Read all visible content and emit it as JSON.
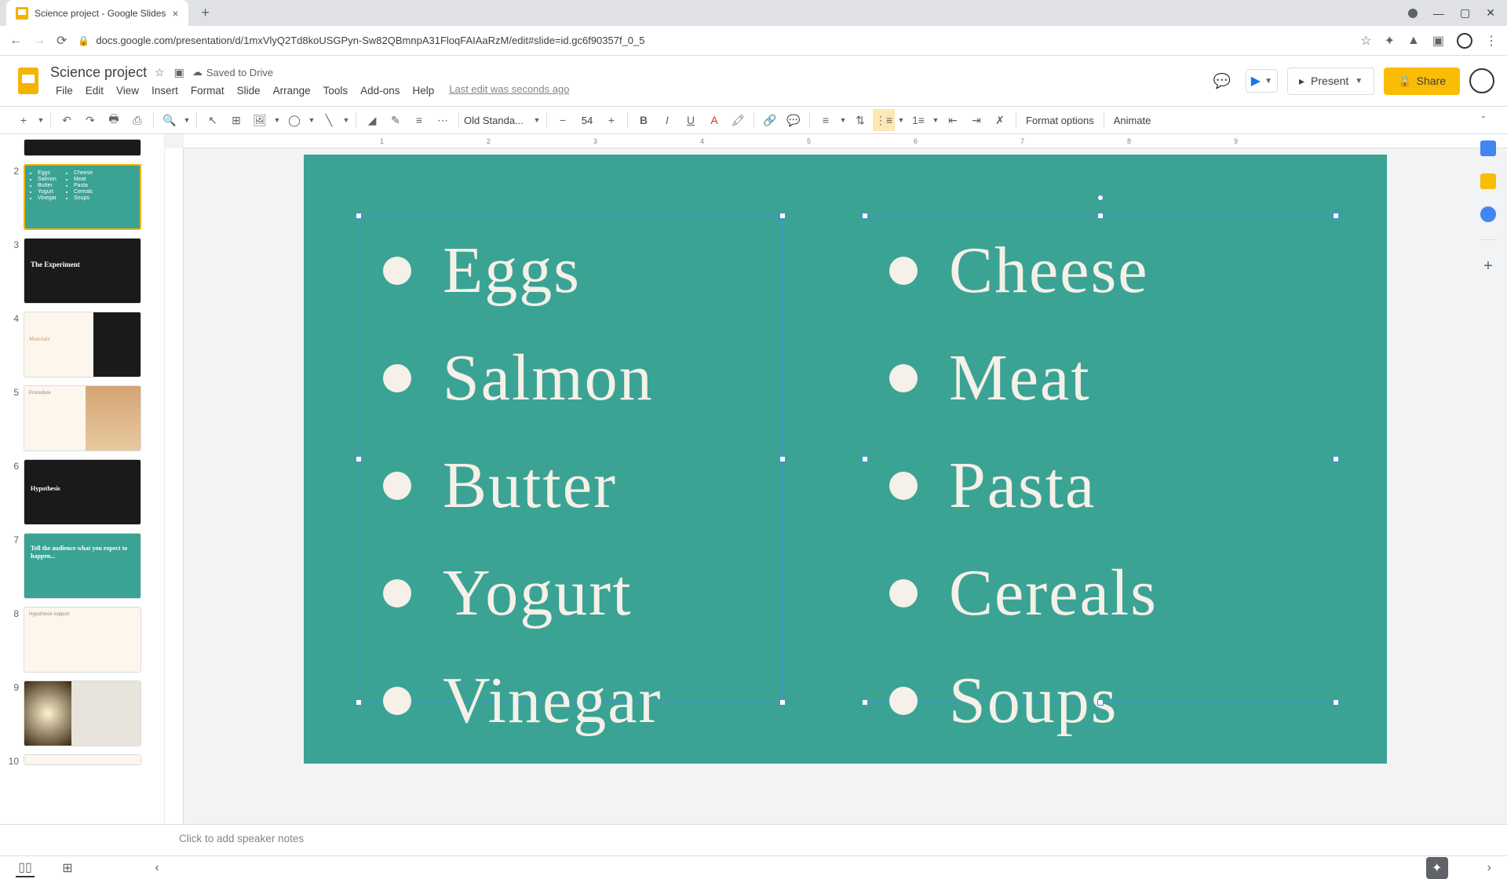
{
  "browser": {
    "tab_title": "Science project - Google Slides",
    "url": "docs.google.com/presentation/d/1mxVlyQ2Td8koUSGPyn-Sw82QBmnpA31FloqFAIAaRzM/edit#slide=id.gc6f90357f_0_5"
  },
  "doc": {
    "title": "Science project",
    "save_status": "Saved to Drive",
    "last_edit": "Last edit was seconds ago"
  },
  "menus": [
    "File",
    "Edit",
    "View",
    "Insert",
    "Format",
    "Slide",
    "Arrange",
    "Tools",
    "Add-ons",
    "Help"
  ],
  "header_buttons": {
    "present": "Present",
    "share": "Share"
  },
  "toolbar": {
    "font": "Old Standa...",
    "font_size": "54",
    "format_options": "Format options",
    "animate": "Animate"
  },
  "slide_content": {
    "left_list": [
      "Eggs",
      "Salmon",
      "Butter",
      "Yogurt",
      "Vinegar"
    ],
    "right_list": [
      "Cheese",
      "Meat",
      "Pasta",
      "Cereals",
      "Soups"
    ]
  },
  "thumbnails": {
    "s3": "The Experiment",
    "s4": "Materials",
    "s5": "Procedure",
    "s6": "Hypothesis",
    "s7": "Tell the audience what you expect to happen...",
    "s8": "Hypothesis support"
  },
  "notes": {
    "placeholder": "Click to add speaker notes"
  },
  "ruler_ticks": [
    "1",
    "2",
    "3",
    "4",
    "5",
    "6",
    "7",
    "8",
    "9"
  ]
}
